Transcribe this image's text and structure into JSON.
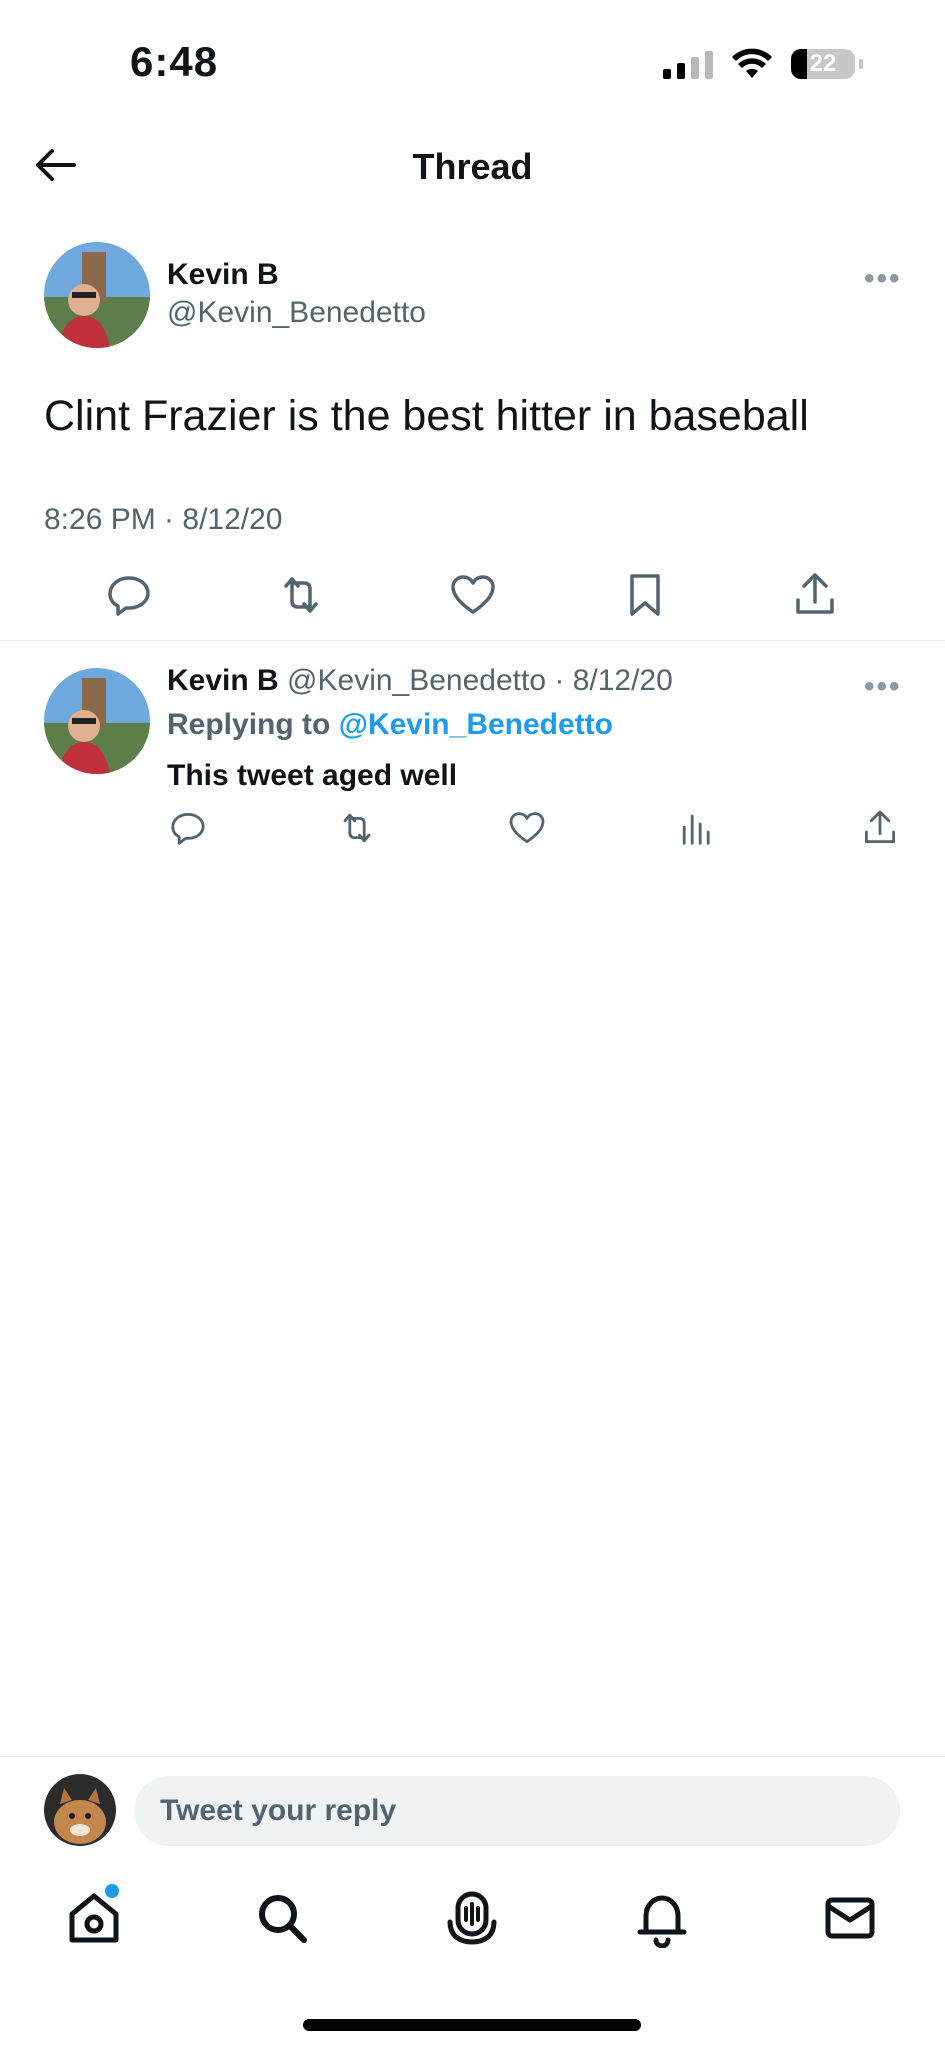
{
  "status_bar": {
    "time": "6:48",
    "battery": "22"
  },
  "header": {
    "title": "Thread"
  },
  "main_tweet": {
    "name": "Kevin B",
    "handle": "@Kevin_Benedetto",
    "text": "Clint Frazier is the best hitter in baseball",
    "timestamp": "8:26 PM · 8/12/20"
  },
  "reply_tweet": {
    "name": "Kevin B",
    "handle": "@Kevin_Benedetto",
    "date": "· 8/12/20",
    "replying_prefix": "Replying to",
    "replying_to": "@Kevin_Benedetto",
    "text": "This tweet aged well"
  },
  "composer": {
    "placeholder": "Tweet your reply"
  },
  "colors": {
    "accent": "#1d9bf0",
    "text": "#0f1419",
    "secondary": "#536471",
    "divider": "#e7e9ea"
  },
  "icons": {
    "main_actions": [
      "reply-icon",
      "retweet-icon",
      "like-icon",
      "bookmark-icon",
      "share-icon"
    ],
    "reply_actions": [
      "reply-icon",
      "retweet-icon",
      "like-icon",
      "analytics-icon",
      "share-icon"
    ],
    "tabs": [
      "home-icon",
      "search-icon",
      "spaces-icon",
      "notifications-icon",
      "messages-icon"
    ]
  }
}
